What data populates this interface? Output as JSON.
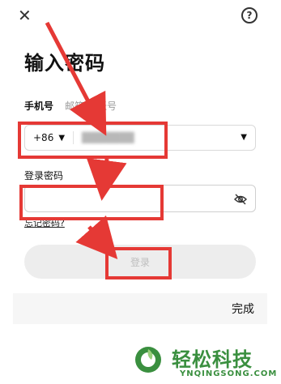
{
  "header": {
    "close_icon": "close-icon",
    "help_icon": "help-icon",
    "help_glyph": "?"
  },
  "page": {
    "title": "输入密码",
    "tabs": [
      {
        "label": "手机号",
        "active": true
      },
      {
        "label": "邮箱/子账号",
        "active": false
      }
    ]
  },
  "phone": {
    "country_code": "+86",
    "value": "███████",
    "dropdown_icon": "caret-down-icon"
  },
  "password": {
    "label": "登录密码",
    "value": "",
    "toggle_icon": "eye-off-icon"
  },
  "links": {
    "forgot_password": "忘记密码?"
  },
  "actions": {
    "login": "登录",
    "done": "完成"
  },
  "watermark": {
    "brand": "轻松科技",
    "domain": "YNQINGSONG.COM"
  },
  "colors": {
    "annotation_red": "#e53935",
    "brand_green": "#3a8f3f",
    "button_disabled": "#ededed"
  }
}
